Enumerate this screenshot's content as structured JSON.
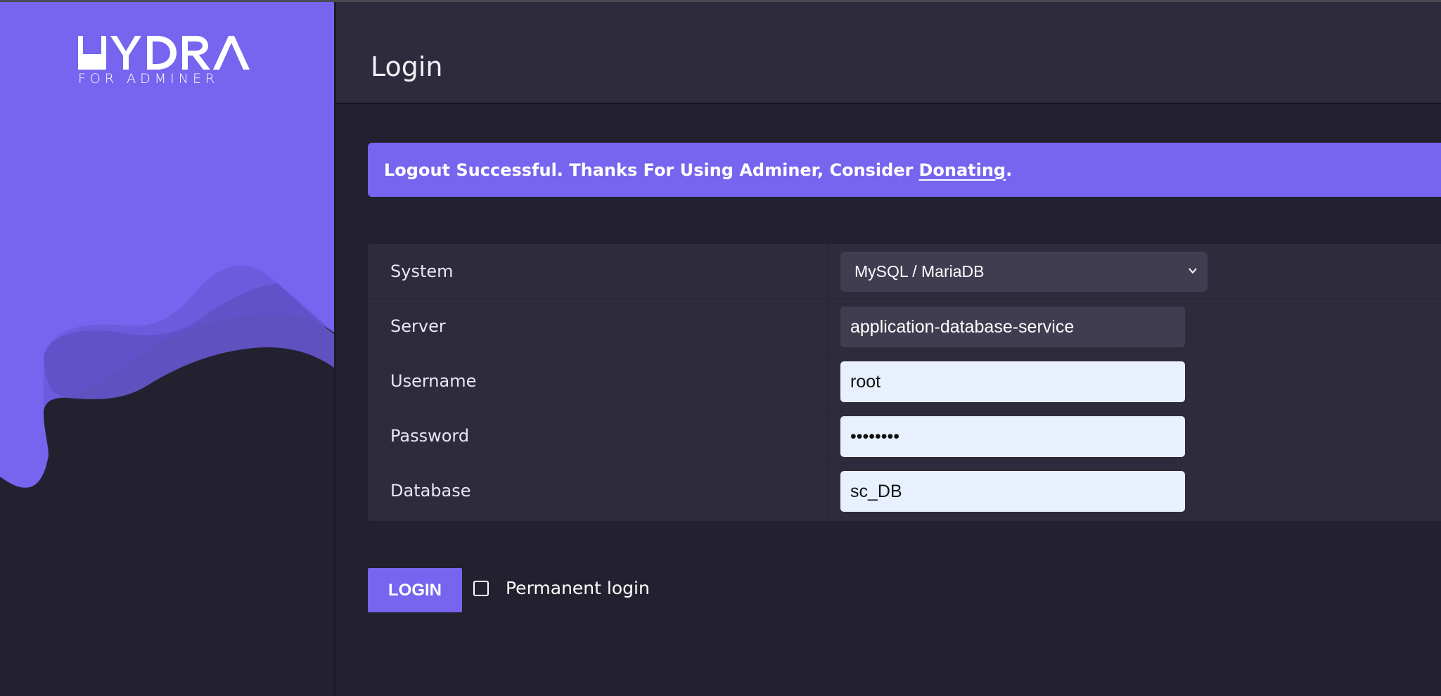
{
  "app": {
    "logo_text": "HYDRA",
    "logo_subtext": "FOR ADMINER"
  },
  "header": {
    "title": "Login"
  },
  "message": {
    "text": "Logout Successful. Thanks For Using Adminer, Consider",
    "link_text": "Donating",
    "suffix": "."
  },
  "form": {
    "system": {
      "label": "System",
      "value": "MySQL / MariaDB"
    },
    "server": {
      "label": "Server",
      "value": "application-database-service"
    },
    "username": {
      "label": "Username",
      "value": "root"
    },
    "password": {
      "label": "Password",
      "value": "••••••••"
    },
    "database": {
      "label": "Database",
      "value": "sc_DB"
    }
  },
  "actions": {
    "login_label": "LOGIN",
    "permanent_login_label": "Permanent login",
    "permanent_login_checked": false
  },
  "colors": {
    "accent": "#7764ef",
    "background": "#23212f",
    "panel": "#2e2c3c",
    "field_autofill": "#e8f0fe"
  },
  "icons": {
    "select_chevron": "chevron-down-icon",
    "checkbox": "checkbox-unchecked-icon"
  }
}
